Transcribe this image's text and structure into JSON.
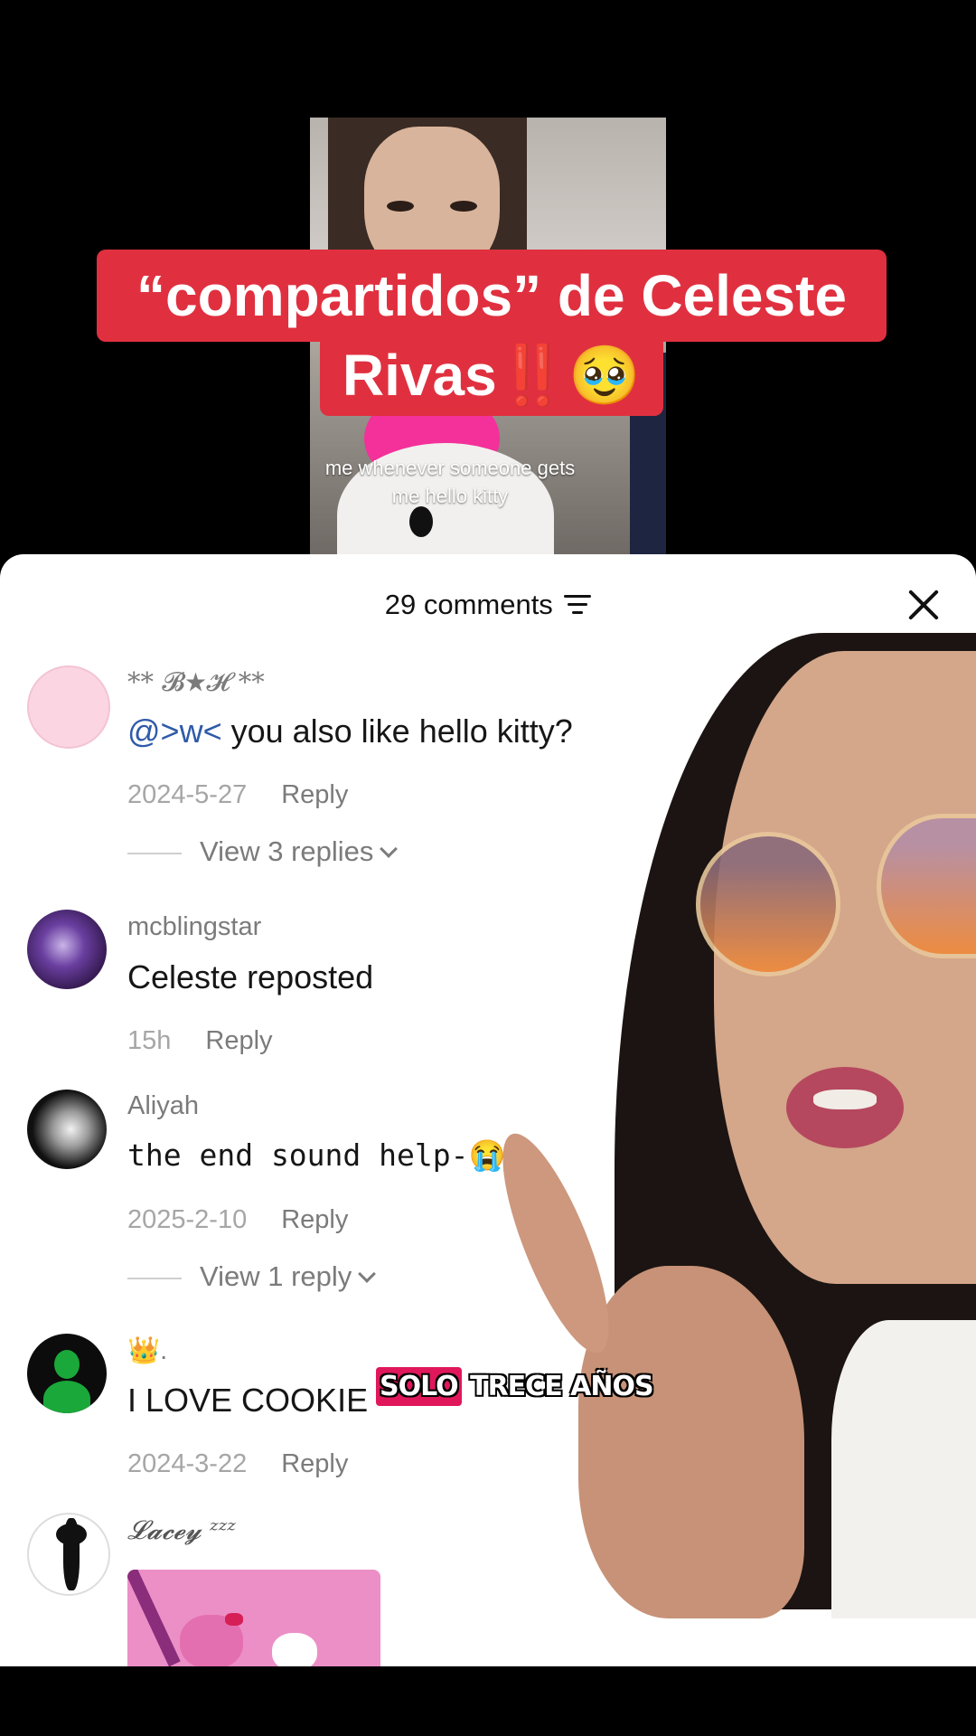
{
  "video": {
    "title_line1": "“compartidos” de Celeste",
    "title_line2": "Rivas",
    "title_emoji": "‼️🥹",
    "caption": "me whenever someone gets me hello kitty"
  },
  "comments_panel": {
    "count_label": "29 comments",
    "sort_icon": "sort-icon",
    "close_icon": "close-icon"
  },
  "comments": [
    {
      "username": "** 𝓑★𝓗 **",
      "mention": "@>w<",
      "text": " you also like hello kitty?",
      "date": "2024-5-27",
      "reply_label": "Reply",
      "view_replies": "View 3 replies"
    },
    {
      "username": "mcblingstar",
      "text": "Celeste reposted",
      "date": "15h",
      "reply_label": "Reply"
    },
    {
      "username": "Aliyah",
      "text": "𝚝𝚑𝚎 𝚎𝚗𝚍 𝚜𝚘𝚞𝚗𝚍 𝚑𝚎𝚕𝚙-😭",
      "date": "2025-2-10",
      "reply_label": "Reply",
      "view_replies": "View 1 reply"
    },
    {
      "username": "👑.",
      "text": "I LOVE COOKIE",
      "date": "2024-3-22",
      "reply_label": "Reply"
    },
    {
      "username": "𝓛𝓪𝓬𝓮𝔂 ᶻᶻᶻ"
    }
  ],
  "overlay_subtitle": {
    "highlight": "SOLO",
    "rest": " TRECE AÑOS"
  },
  "colors": {
    "title_bg": "#e0303f",
    "mention": "#2f5aa8",
    "subtitle_highlight": "#e0185b"
  }
}
